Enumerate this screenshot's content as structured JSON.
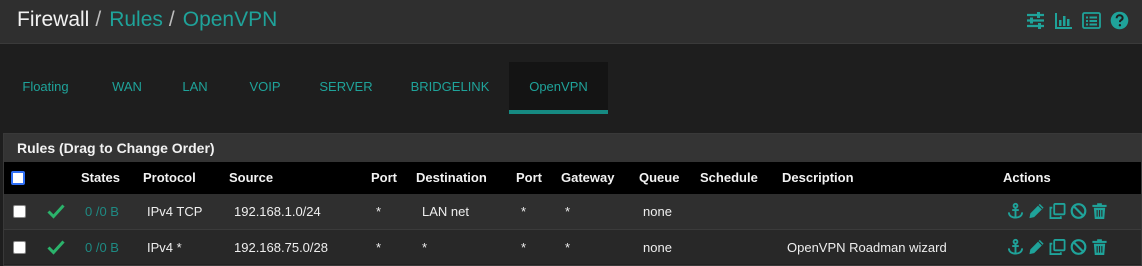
{
  "breadcrumb": {
    "root": "Firewall",
    "separator": "/",
    "items": [
      "Rules",
      "OpenVPN"
    ]
  },
  "header_icons": [
    "sliders-icon",
    "bar-chart-icon",
    "list-icon",
    "help-icon"
  ],
  "tabs": [
    {
      "label": "Floating",
      "active": false
    },
    {
      "label": "WAN",
      "active": false
    },
    {
      "label": "LAN",
      "active": false
    },
    {
      "label": "VOIP",
      "active": false
    },
    {
      "label": "SERVER",
      "active": false
    },
    {
      "label": "BRIDGELINK",
      "active": false
    },
    {
      "label": "OpenVPN",
      "active": true
    }
  ],
  "panel": {
    "title": "Rules (Drag to Change Order)",
    "columns": [
      "States",
      "Protocol",
      "Source",
      "Port",
      "Destination",
      "Port",
      "Gateway",
      "Queue",
      "Schedule",
      "Description",
      "Actions"
    ],
    "rows": [
      {
        "enabled": true,
        "states": "0 /0 B",
        "protocol": "IPv4 TCP",
        "source": "192.168.1.0/24",
        "source_port": "*",
        "destination": "LAN net",
        "destination_port": "*",
        "gateway": "*",
        "queue": "none",
        "schedule": "",
        "description": "",
        "actions": [
          "anchor-icon",
          "edit-icon",
          "copy-icon",
          "disable-icon",
          "delete-icon"
        ]
      },
      {
        "enabled": true,
        "states": "0 /0 B",
        "protocol": "IPv4 *",
        "source": "192.168.75.0/28",
        "source_port": "*",
        "destination": "*",
        "destination_port": "*",
        "gateway": "*",
        "queue": "none",
        "schedule": "",
        "description": "OpenVPN Roadman wizard",
        "actions": [
          "anchor-icon",
          "edit-icon",
          "copy-icon",
          "disable-icon",
          "delete-icon"
        ]
      }
    ]
  },
  "colors": {
    "accent": "#1fa39a",
    "header_bg": "#2f2f2f",
    "page_bg": "#1e1e1e",
    "table_head_bg": "#000000",
    "enabled_check": "#2bb36b"
  }
}
